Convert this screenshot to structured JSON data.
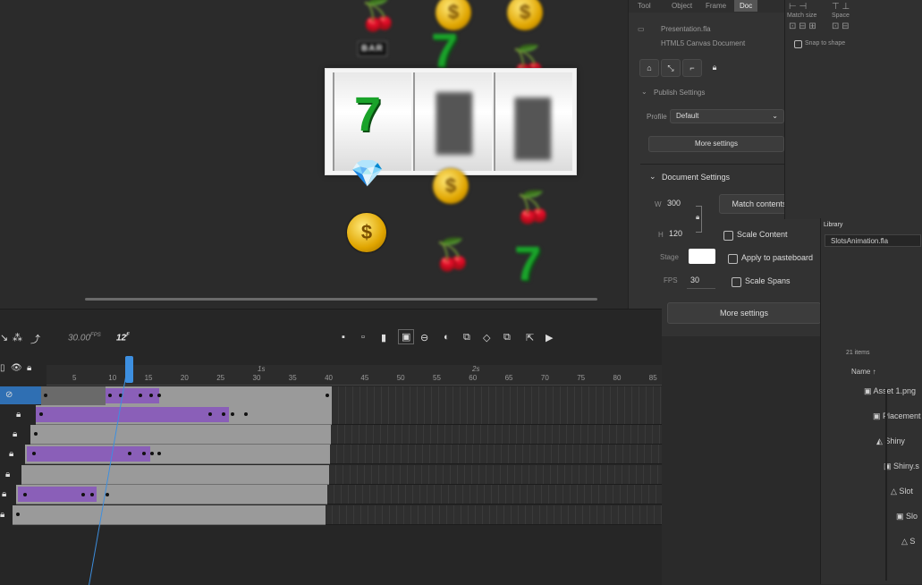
{
  "stage": {
    "symbols": {
      "bar": "BAR",
      "seven": "7",
      "coin": "$",
      "cherry": "🍒",
      "gem": "💎"
    }
  },
  "properties": {
    "tabs": [
      "Tool",
      "Object",
      "Frame",
      "Doc"
    ],
    "doc_type_line1": "Presentation.fla",
    "doc_type_line2": "HTML5 Canvas Document",
    "publish_settings_title": "Publish Settings",
    "profile_label": "Profile",
    "profile_value": "Default",
    "more_settings_1": "More settings",
    "document_settings_title": "Document Settings",
    "w_label": "W",
    "w_value": "300",
    "h_label": "H",
    "h_value": "120",
    "match_contents": "Match contents",
    "scale_content": "Scale Content",
    "stage_label": "Stage",
    "stage_color": "#ffffff",
    "apply_to_pasteboard": "Apply to pasteboard",
    "fps_label": "FPS",
    "fps_value": "30",
    "scale_spans": "Scale Spans",
    "more_settings_2": "More settings"
  },
  "far_right": {
    "labels": [
      "Match size",
      "Space"
    ],
    "snap_label": "Snap to shape"
  },
  "library": {
    "title": "Library",
    "file": "SlotsAnimation.fla",
    "count": "21 items",
    "name_header": "Name ↑",
    "items": [
      "Asset 1.png",
      "Placement",
      "Shiny",
      "Shiny.s",
      "Slot",
      "Slo",
      "S"
    ]
  },
  "timeline": {
    "fps": "30.00",
    "fps_unit": "FPS",
    "frame": "12",
    "frame_unit": "F",
    "ruler_numbers": [
      "5",
      "10",
      "15",
      "20",
      "25",
      "30",
      "35",
      "40",
      "45",
      "50",
      "55",
      "60",
      "65",
      "70",
      "75",
      "80",
      "85"
    ],
    "second_markers": [
      "1s",
      "2s"
    ],
    "ruler_ticks_start": 5
  },
  "colors": {
    "accent": "#3d8fe0",
    "tween": "#8a5fb8",
    "green7": "#1aa32a"
  }
}
